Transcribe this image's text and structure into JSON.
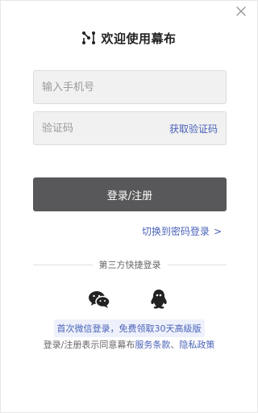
{
  "title": "欢迎使用幕布",
  "phone_input": {
    "placeholder": "输入手机号",
    "value": ""
  },
  "code_input": {
    "placeholder": "验证码",
    "value": ""
  },
  "get_code_label": "获取验证码",
  "login_button_label": "登录/注册",
  "switch_link_label": "切换到密码登录",
  "switch_link_chevron": ">",
  "divider_text": "第三方快捷登录",
  "social": [
    {
      "name": "wechat",
      "icon": "wechat-icon"
    },
    {
      "name": "qq",
      "icon": "qq-icon"
    }
  ],
  "promo_text": "首次微信登录，免费领取30天高级版",
  "terms": {
    "prefix": "登录/注册表示同意幕布",
    "service_link": "服务条款",
    "separator": "、",
    "privacy_link": "隐私政策"
  },
  "colors": {
    "accent_link": "#4a63b8",
    "button_bg": "#58585a",
    "field_bg": "#f1f1f1",
    "promo_bg": "#eef1fb"
  }
}
